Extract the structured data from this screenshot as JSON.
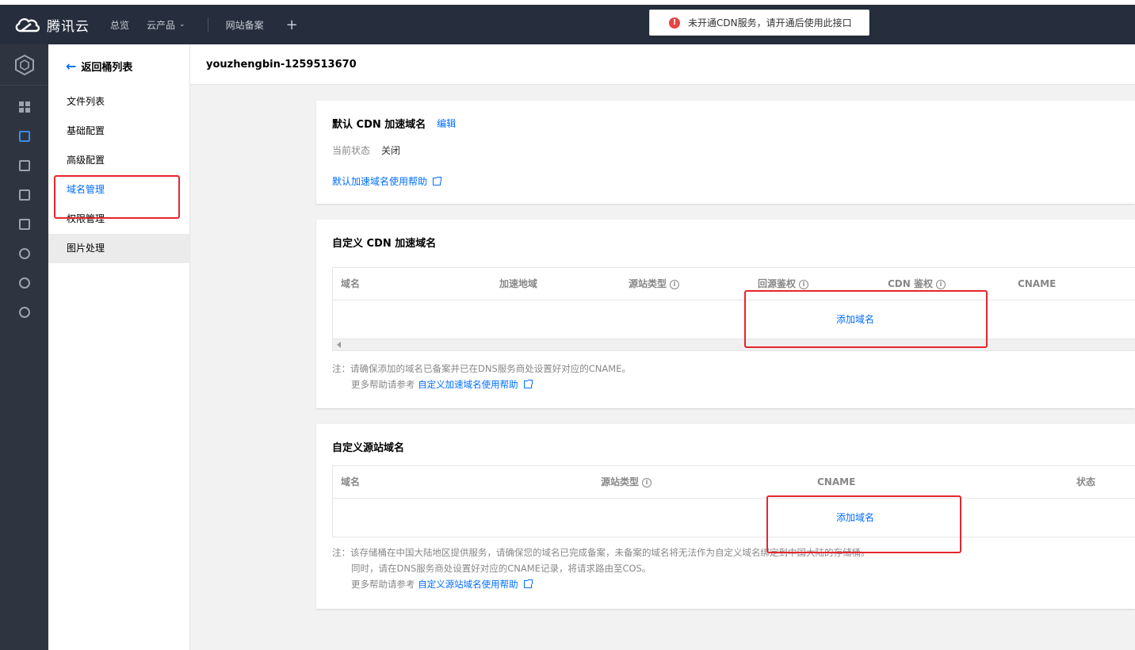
{
  "topbar": {
    "brand": "腾讯云",
    "nav": {
      "overview": "总览",
      "products": "云产品",
      "icp": "网站备案",
      "plus": "+"
    }
  },
  "alert": {
    "icon": "!",
    "text": "未开通CDN服务，请开通后使用此接口"
  },
  "sidebar": {
    "back": "返回桶列表",
    "items": [
      "文件列表",
      "基础配置",
      "高级配置",
      "域名管理",
      "权限管理",
      "图片处理"
    ]
  },
  "page": {
    "bucket": "youzhengbin-1259513670"
  },
  "default_cdn": {
    "title": "默认 CDN 加速域名",
    "edit": "编辑",
    "status_label": "当前状态",
    "status_value": "关闭",
    "help": "默认加速域名使用帮助"
  },
  "custom_cdn": {
    "title": "自定义 CDN 加速域名",
    "columns": [
      "域名",
      "加速地域",
      "源站类型",
      "回源鉴权",
      "CDN 鉴权",
      "CNAME"
    ],
    "add": "添加域名",
    "note1": "注：请确保添加的域名已备案并已在DNS服务商处设置好对应的CNAME。",
    "note2_prefix": "更多帮助请参考",
    "note2_link": "自定义加速域名使用帮助"
  },
  "custom_origin": {
    "title": "自定义源站域名",
    "columns": [
      "域名",
      "源站类型",
      "CNAME",
      "状态"
    ],
    "add": "添加域名",
    "note1": "注：该存储桶在中国大陆地区提供服务，请确保您的域名已完成备案，未备案的域名将无法作为自定义域名绑定到中国大陆的存储桶。",
    "note2": "同时，请在DNS服务商处设置好对应的CNAME记录，将请求路由至COS。",
    "note3_prefix": "更多帮助请参考",
    "note3_link": "自定义源站域名使用帮助"
  },
  "icons": [
    "tencent-cloud-logo-icon",
    "cube-icon",
    "dashboard-icon",
    "storage-icon",
    "checklist-icon",
    "image-icon",
    "calendar-icon",
    "settings-icon",
    "list-icon",
    "coin-icon",
    "info-icon",
    "external-link-icon",
    "arrow-left-icon",
    "chevron-down-icon",
    "alert-icon"
  ],
  "colors": {
    "accent": "#006eff",
    "highlight": "#e5262d",
    "topbar": "#262e3d"
  }
}
